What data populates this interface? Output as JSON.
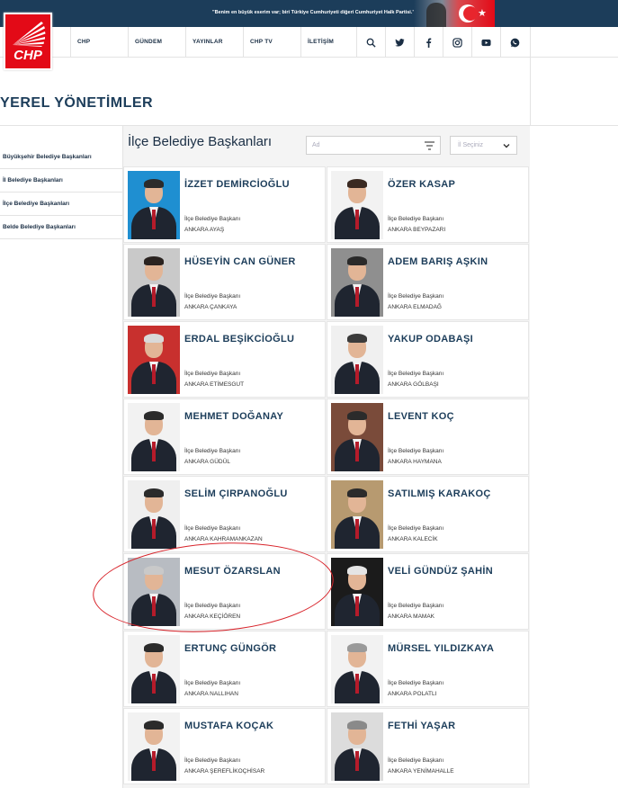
{
  "topbar": {
    "slogan": "\"Benim en büyük eserim var; biri Türkiye Cumhuriyeti diğeri Cumhuriyet Halk Partisi.\""
  },
  "brand": {
    "logo_text": "CHP",
    "primary": "#e30a17",
    "navy": "#1c3d5a"
  },
  "nav": {
    "items": [
      "CHP",
      "GÜNDEM",
      "YAYINLAR",
      "CHP TV",
      "İLETİŞİM"
    ],
    "icons": [
      "search-icon",
      "twitter-icon",
      "facebook-icon",
      "instagram-icon",
      "youtube-icon",
      "whatsapp-icon"
    ]
  },
  "page": {
    "title": "YEREL YÖNETİMLER"
  },
  "sidebar": {
    "items": [
      {
        "label": "Büyükşehir Belediye Başkanları"
      },
      {
        "label": "İl Belediye Başkanları"
      },
      {
        "label": "İlçe Belediye Başkanları"
      },
      {
        "label": "Belde Belediye Başkanları"
      }
    ]
  },
  "list": {
    "title": "İlçe Belediye Başkanları",
    "search_placeholder": "Ad",
    "select_placeholder": "İl Seçiniz"
  },
  "mayors": [
    {
      "name": "İZZET DEMİRCİOĞLU",
      "role": "İlçe Belediye Başkanı",
      "place": "ANKARA AYAŞ",
      "bg": "#1f8fd1",
      "hair": "#2b2b2b"
    },
    {
      "name": "ÖZER KASAP",
      "role": "İlçe Belediye Başkanı",
      "place": "ANKARA BEYPAZARI",
      "bg": "#f2f2f2",
      "hair": "#3a2a22"
    },
    {
      "name": "HÜSEYİN CAN GÜNER",
      "role": "İlçe Belediye Başkanı",
      "place": "ANKARA ÇANKAYA",
      "bg": "#c9c9c9",
      "hair": "#2a2320"
    },
    {
      "name": "ADEM BARIŞ AŞKIN",
      "role": "İlçe Belediye Başkanı",
      "place": "ANKARA ELMADAĞ",
      "bg": "#8f8f8f",
      "hair": "#2a2a2a"
    },
    {
      "name": "ERDAL BEŞİKCİOĞLU",
      "role": "İlçe Belediye Başkanı",
      "place": "ANKARA ETİMESGUT",
      "bg": "#c8302e",
      "hair": "#d9d9d9"
    },
    {
      "name": "YAKUP ODABAŞI",
      "role": "İlçe Belediye Başkanı",
      "place": "ANKARA GÖLBAŞI",
      "bg": "#f0f0f0",
      "hair": "#3b3b3b"
    },
    {
      "name": "MEHMET DOĞANAY",
      "role": "İlçe Belediye Başkanı",
      "place": "ANKARA GÜDÜL",
      "bg": "#f2f2f2",
      "hair": "#2b2b2b"
    },
    {
      "name": "LEVENT KOÇ",
      "role": "İlçe Belediye Başkanı",
      "place": "ANKARA HAYMANA",
      "bg": "#7a4b3a",
      "hair": "#2b2b2b"
    },
    {
      "name": "SELİM ÇIRPANOĞLU",
      "role": "İlçe Belediye Başkanı",
      "place": "ANKARA KAHRAMANKAZAN",
      "bg": "#efefef",
      "hair": "#2b2b2b"
    },
    {
      "name": "SATILMIŞ KARAKOÇ",
      "role": "İlçe Belediye Başkanı",
      "place": "ANKARA KALECİK",
      "bg": "#b79a70",
      "hair": "#2b2b2b"
    },
    {
      "name": "MESUT ÖZARSLAN",
      "role": "İlçe Belediye Başkanı",
      "place": "ANKARA KEÇİÖREN",
      "bg": "#b8bcc2",
      "hair": "#c9c9c9"
    },
    {
      "name": "VELİ GÜNDÜZ ŞAHİN",
      "role": "İlçe Belediye Başkanı",
      "place": "ANKARA MAMAK",
      "bg": "#1b1b1b",
      "hair": "#e5e5e5"
    },
    {
      "name": "ERTUNÇ GÜNGÖR",
      "role": "İlçe Belediye Başkanı",
      "place": "ANKARA NALLIHAN",
      "bg": "#f2f2f2",
      "hair": "#2b2b2b"
    },
    {
      "name": "MÜRSEL YILDIZKAYA",
      "role": "İlçe Belediye Başkanı",
      "place": "ANKARA POLATLI",
      "bg": "#f2f2f2",
      "hair": "#9a9a9a"
    },
    {
      "name": "MUSTAFA KOÇAK",
      "role": "İlçe Belediye Başkanı",
      "place": "ANKARA ŞEREFLİKOÇHİSAR",
      "bg": "#f2f2f2",
      "hair": "#2b2b2b"
    },
    {
      "name": "FETHİ YAŞAR",
      "role": "İlçe Belediye Başkanı",
      "place": "ANKARA YENİMAHALLE",
      "bg": "#dcdcdc",
      "hair": "#8a8a8a"
    }
  ]
}
